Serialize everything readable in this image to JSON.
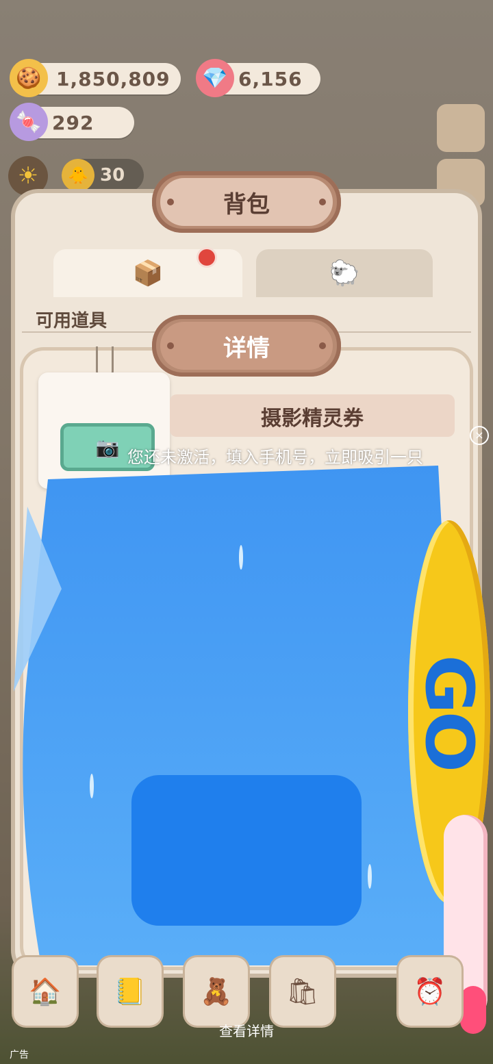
{
  "resources": {
    "coins": "1,850,809",
    "gems": "6,156",
    "candy": "292",
    "chick_count": "30"
  },
  "backpack": {
    "title": "背包",
    "section_label": "可用道具"
  },
  "detail_dialog": {
    "title": "详情",
    "item_name": "摄影精灵券"
  },
  "ad": {
    "overlay_text": "您还未激活，填入手机号，立即吸引一只",
    "go_label": "GO",
    "view_details": "查看详情",
    "ad_tag": "广告",
    "close_symbol": "×",
    "card_color": "#4aa3f7",
    "coin_color": "#f6c81a"
  },
  "icons": {
    "coin": "cookie-coin-icon",
    "gem": "pink-gem-icon",
    "candy": "candy-icon",
    "sun": "sun-icon",
    "chick": "chick-icon",
    "tab_items": "box-icon",
    "tab_pets": "sheep-icon"
  }
}
